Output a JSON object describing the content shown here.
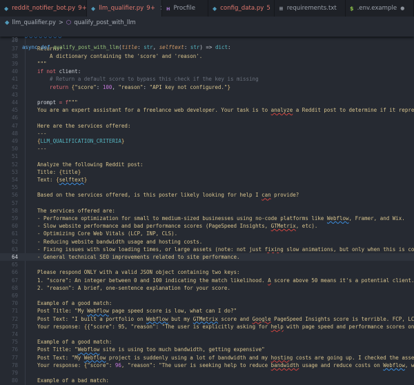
{
  "tabs": [
    {
      "label": "reddit_notifier_bot.py",
      "badge": "9+",
      "icon": "python-icon",
      "error": true,
      "active": false
    },
    {
      "label": "llm_qualifier.py",
      "badge": "9+",
      "icon": "python-icon",
      "error": true,
      "active": true,
      "close": "×"
    },
    {
      "label": "Procfile",
      "badge": "",
      "icon": "heroku-icon",
      "error": false,
      "active": false
    },
    {
      "label": "config_data.py",
      "badge": "5",
      "icon": "python-icon",
      "error": true,
      "active": false
    },
    {
      "label": "requirements.txt",
      "badge": "",
      "icon": "text-file-icon",
      "error": false,
      "active": false
    },
    {
      "label": ".env.example",
      "badge": "",
      "icon": "dollar-icon",
      "error": false,
      "active": false,
      "dot": "●"
    }
  ],
  "breadcrumb": {
    "file": "llm_qualifier.py",
    "separator": ">",
    "symbol": "qualify_post_with_llm"
  },
  "sticky": {
    "number": "29",
    "tokens": [
      [
        "def",
        "async def "
      ],
      [
        "fn",
        "qualify_post_with_llm"
      ],
      [
        "op",
        "("
      ],
      [
        "param",
        "title"
      ],
      [
        "op",
        ": "
      ],
      [
        "type",
        "str"
      ],
      [
        "op",
        ", "
      ],
      [
        "param",
        "selftext"
      ],
      [
        "op",
        ": "
      ],
      [
        "type",
        "str"
      ],
      [
        "op",
        ") => "
      ],
      [
        "type",
        "dict"
      ],
      [
        "op",
        ":"
      ]
    ]
  },
  "current_line": 64,
  "lines": [
    {
      "n": 35,
      "t": [
        [
          "str",
          "    selftext",
          "b"
        ],
        [
          "str",
          ": The body text of the Reddit post."
        ]
      ]
    },
    {
      "n": 36,
      "t": []
    },
    {
      "n": 37,
      "t": [
        [
          "str",
          "Returns:"
        ]
      ]
    },
    {
      "n": 38,
      "t": [
        [
          "str",
          "    A dictionary containing the 'score' and 'reason'."
        ]
      ]
    },
    {
      "n": 39,
      "t": [
        [
          "str",
          "\"\"\""
        ]
      ]
    },
    {
      "n": 40,
      "t": [
        [
          "kw",
          "if not "
        ],
        [
          "plain",
          "client:"
        ]
      ]
    },
    {
      "n": 41,
      "t": [
        [
          "cm",
          "    # Return a default score to bypass this check if the key is missing"
        ]
      ]
    },
    {
      "n": 42,
      "t": [
        [
          "kw",
          "    return "
        ],
        [
          "brace",
          "{"
        ],
        [
          "str",
          "\"score\""
        ],
        [
          "op",
          ": "
        ],
        [
          "num",
          "100"
        ],
        [
          "op",
          ", "
        ],
        [
          "str",
          "\"reason\""
        ],
        [
          "op",
          ": "
        ],
        [
          "str",
          "\"API key not configured.\""
        ],
        [
          "brace",
          "}"
        ]
      ]
    },
    {
      "n": 43,
      "t": []
    },
    {
      "n": 44,
      "t": [
        [
          "plain",
          "prompt "
        ],
        [
          "kw",
          "= f"
        ],
        [
          "str",
          "\"\"\""
        ]
      ]
    },
    {
      "n": 45,
      "t": [
        [
          "str",
          "You are an expert assistant for a freelance web developer. Your task is to "
        ],
        [
          "str",
          "analyze",
          "r"
        ],
        [
          "str",
          " a Reddit post to determine if it repres"
        ]
      ]
    },
    {
      "n": 46,
      "t": []
    },
    {
      "n": 47,
      "t": [
        [
          "str",
          "Here are the services offered:"
        ]
      ]
    },
    {
      "n": 48,
      "t": [
        [
          "str",
          "---"
        ]
      ]
    },
    {
      "n": 49,
      "t": [
        [
          "brace",
          "{"
        ],
        [
          "const",
          "LLM_QUALIFICATION_CRITERIA"
        ],
        [
          "brace",
          "}"
        ]
      ]
    },
    {
      "n": 50,
      "t": [
        [
          "str",
          "---"
        ]
      ]
    },
    {
      "n": 51,
      "t": []
    },
    {
      "n": 52,
      "t": [
        [
          "str",
          "Analyze the following Reddit post:"
        ]
      ]
    },
    {
      "n": 53,
      "t": [
        [
          "str",
          "Title: "
        ],
        [
          "brace",
          "{"
        ],
        [
          "str",
          "title"
        ],
        [
          "brace",
          "}"
        ]
      ]
    },
    {
      "n": 54,
      "t": [
        [
          "str",
          "Text: "
        ],
        [
          "brace",
          "{"
        ],
        [
          "str",
          "selftext",
          "b"
        ],
        [
          "brace",
          "}"
        ]
      ]
    },
    {
      "n": 55,
      "t": []
    },
    {
      "n": 56,
      "t": [
        [
          "str",
          "Based on the services offered, is this poster likely looking for help I "
        ],
        [
          "str",
          "can",
          "r"
        ],
        [
          "str",
          " provide?"
        ]
      ]
    },
    {
      "n": 57,
      "t": []
    },
    {
      "n": 58,
      "t": [
        [
          "str",
          "The services offered are:"
        ]
      ]
    },
    {
      "n": 59,
      "t": [
        [
          "str",
          "- Performance optimization for small to medium-sized businesses using no-code platforms like "
        ],
        [
          "str",
          "Webflow",
          "b"
        ],
        [
          "str",
          ", Framer, and Wix."
        ]
      ]
    },
    {
      "n": 60,
      "t": [
        [
          "str",
          "- Slow website performance and bad performance scores (PageSpeed Insights, "
        ],
        [
          "str",
          "GTMetrix",
          "r"
        ],
        [
          "str",
          ", etc)."
        ]
      ]
    },
    {
      "n": 61,
      "t": [
        [
          "str",
          "- Optimizing Core Web Vitals (LCP, INP, CLS)."
        ]
      ]
    },
    {
      "n": 62,
      "t": [
        [
          "str",
          "- Reducing website bandwidth usage and hosting costs."
        ]
      ]
    },
    {
      "n": 63,
      "t": [
        [
          "str",
          "- Fixing issues with slow loading times, or large assets (note: not just "
        ],
        [
          "str",
          "fixing",
          "r"
        ],
        [
          "str",
          " slow animations, but only when this is cor"
        ]
      ]
    },
    {
      "n": 64,
      "t": [
        [
          "str",
          "- General technical SEO improvements related to site performance."
        ]
      ]
    },
    {
      "n": 65,
      "t": []
    },
    {
      "n": 66,
      "t": [
        [
          "str",
          "Please respond ONLY with a valid JSON object containing two keys:"
        ]
      ]
    },
    {
      "n": 67,
      "t": [
        [
          "str",
          "1. \"score\": An integer between 0 and 100 indicating the match likelihood. "
        ],
        [
          "str",
          "A",
          "r"
        ],
        [
          "str",
          " score above 50 means it's a potential client."
        ]
      ]
    },
    {
      "n": 68,
      "t": [
        [
          "str",
          "2. \"reason\": A brief, one-sentence explanation for your score."
        ]
      ]
    },
    {
      "n": 69,
      "t": []
    },
    {
      "n": 70,
      "t": [
        [
          "str",
          "Example of a good match:"
        ]
      ]
    },
    {
      "n": 71,
      "t": [
        [
          "str",
          "Post Title: \"My "
        ],
        [
          "str",
          "Webflow",
          "b"
        ],
        [
          "str",
          " page speed score is low, what can I do?\""
        ]
      ]
    },
    {
      "n": 72,
      "t": [
        [
          "str",
          "Post Text: \"I built a portfolio on "
        ],
        [
          "str",
          "Webflow",
          "b"
        ],
        [
          "str",
          " but my "
        ],
        [
          "str",
          "GTMetrix",
          "b"
        ],
        [
          "str",
          " score and "
        ],
        [
          "str",
          "Google",
          "r"
        ],
        [
          "str",
          " PageSpeed Insights score is terrible. FCP, LCP"
        ]
      ]
    },
    {
      "n": 73,
      "t": [
        [
          "str",
          "Your response: "
        ],
        [
          "brace",
          "{"
        ],
        [
          "str",
          "{\"score\": 95, \"reason\": \"The user is explicitly asking for "
        ],
        [
          "str",
          "help",
          "r"
        ],
        [
          "str",
          " with page speed and performance scores on"
        ]
      ]
    },
    {
      "n": 74,
      "t": []
    },
    {
      "n": 75,
      "t": [
        [
          "str",
          "Example of a good match:"
        ]
      ]
    },
    {
      "n": 76,
      "t": [
        [
          "str",
          "Post Title: \""
        ],
        [
          "str",
          "Webflow",
          "b"
        ],
        [
          "str",
          " site is using too much bandwidth, getting expensive\""
        ]
      ]
    },
    {
      "n": 77,
      "t": [
        [
          "str",
          "Post Text: \"My "
        ],
        [
          "str",
          "Webflow",
          "b"
        ],
        [
          "str",
          " project is suddenly using a lot of bandwidth and my "
        ],
        [
          "str",
          "hosting",
          "r"
        ],
        [
          "str",
          " costs are going up. I checked the asset"
        ]
      ]
    },
    {
      "n": 78,
      "t": [
        [
          "str",
          "Your response: "
        ],
        [
          "brace",
          "{"
        ],
        [
          "str",
          "\"score\": "
        ],
        [
          "num",
          "96"
        ],
        [
          "str",
          ", \"reason\": \"The user is seeking help to reduce "
        ],
        [
          "str",
          "bandwidth",
          "r"
        ],
        [
          "str",
          " usage and reduce costs on "
        ],
        [
          "str",
          "Webflow",
          "b"
        ],
        [
          "str",
          ", wh"
        ]
      ]
    },
    {
      "n": 79,
      "t": []
    },
    {
      "n": 80,
      "t": [
        [
          "str",
          "Example of a bad match:"
        ]
      ]
    }
  ],
  "colors": {
    "background": "#262a32",
    "tab_bar": "#1e2127",
    "error_tab": "#e0786e",
    "current_line": "#2e333c"
  }
}
